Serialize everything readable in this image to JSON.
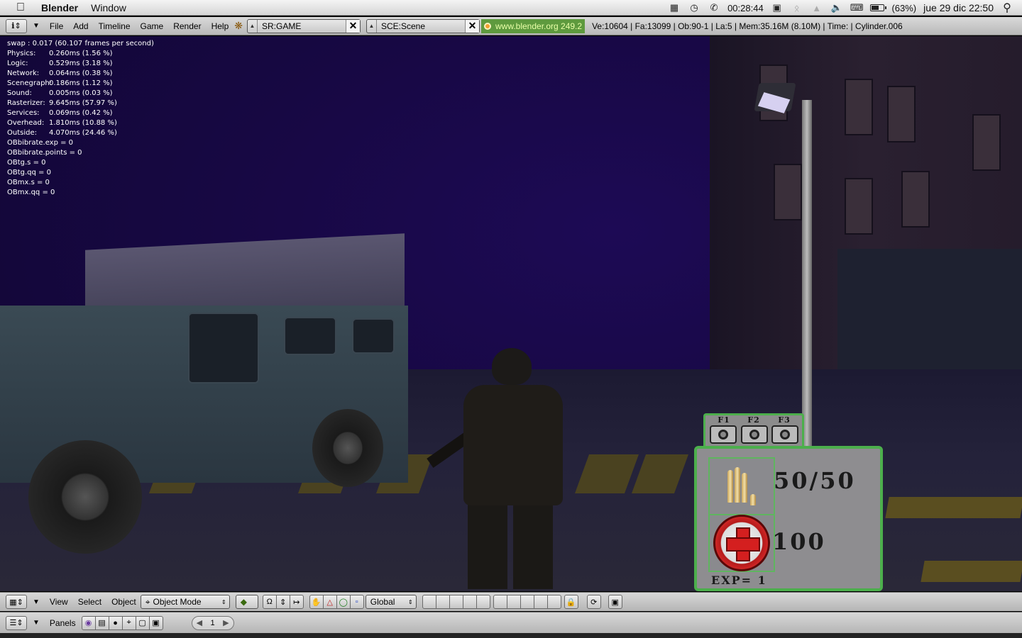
{
  "macbar": {
    "app_name": "Blender",
    "menus": [
      "Window"
    ],
    "clock_duration": "00:28:44",
    "battery": "(63%)",
    "battery_level": 0.63,
    "datetime": "jue 29 dic  22:50"
  },
  "header": {
    "menus": [
      "File",
      "Add",
      "Timeline",
      "Game",
      "Render",
      "Help"
    ],
    "screen": "SR:GAME",
    "scene": "SCE:Scene",
    "website": "www.blender.org 249.2",
    "stats": "Ve:10604 | Fa:13099 | Ob:90-1 | La:5  | Mem:35.16M (8.10M)  | Time: | Cylinder.006"
  },
  "debug": {
    "swap": "swap : 0.017 (60.107 frames per second)",
    "profile": [
      {
        "k": "Physics:",
        "v": "0.260ms (1.56 %)"
      },
      {
        "k": "Logic:",
        "v": "0.529ms (3.18 %)"
      },
      {
        "k": "Network:",
        "v": "0.064ms (0.38 %)"
      },
      {
        "k": "Scenegraph:",
        "v": "0.186ms (1.12 %)"
      },
      {
        "k": "Sound:",
        "v": "0.005ms (0.03 %)"
      },
      {
        "k": "Rasterizer:",
        "v": "9.645ms (57.97 %)"
      },
      {
        "k": "Services:",
        "v": "0.069ms (0.42 %)"
      },
      {
        "k": "Overhead:",
        "v": "1.810ms (10.88 %)"
      },
      {
        "k": "Outside:",
        "v": "4.070ms (24.46 %)"
      }
    ],
    "props": [
      "OBbibrate.exp = 0",
      "OBbibrate.points = 0",
      "OBtg.s = 0",
      "OBtg.qq = 0",
      "OBmx.s = 0",
      "OBmx.qq = 0"
    ]
  },
  "hud": {
    "cameras": [
      "F1",
      "F2",
      "F3"
    ],
    "ammo": "50/50",
    "health": "100",
    "exp": "EXP= 1"
  },
  "viewbar": {
    "menus": [
      "View",
      "Select",
      "Object"
    ],
    "mode": "Object Mode",
    "orientation": "Global"
  },
  "panelsbar": {
    "label": "Panels",
    "frame": "1"
  }
}
